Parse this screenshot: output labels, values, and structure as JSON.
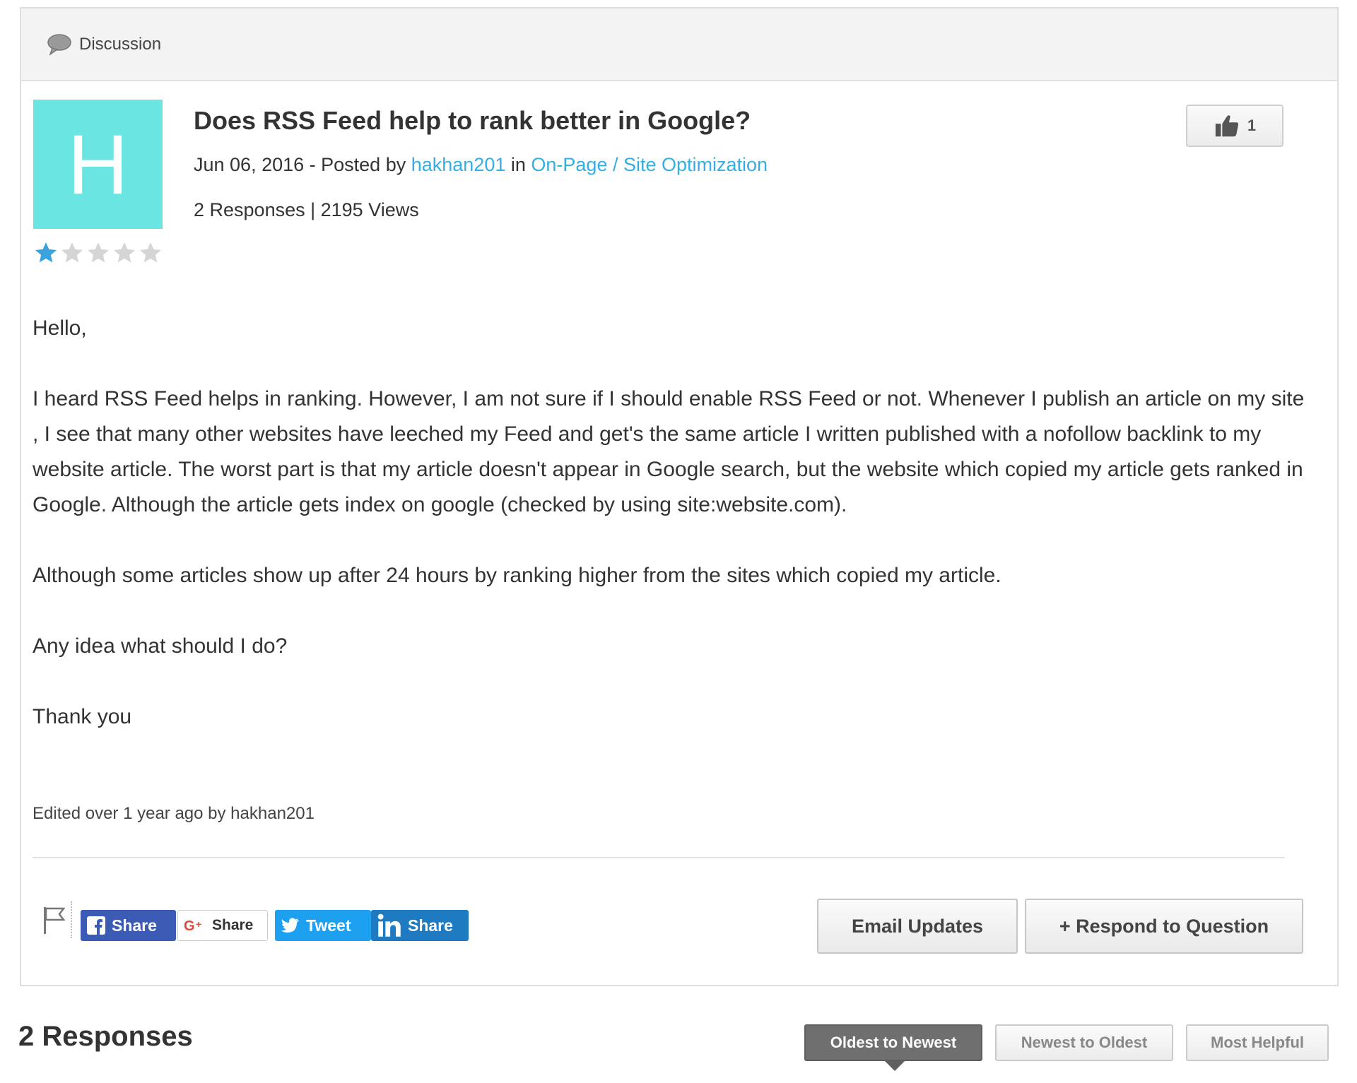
{
  "panel": {
    "header_label": "Discussion",
    "header_icon": "speech-bubble-icon"
  },
  "question": {
    "avatar_letter": "H",
    "avatar_color": "#6be5e2",
    "rating": 1,
    "rating_max": 5,
    "title": "Does RSS Feed help to rank better in Google?",
    "date_prefix": "Jun 06, 2016 - Posted by ",
    "author": "hakhan201",
    "in_word": " in ",
    "category": "On-Page / Site Optimization",
    "stats": "2 Responses | 2195 Views",
    "likes": "1",
    "body": [
      "Hello,",
      "I heard RSS Feed helps in ranking. However, I am not sure if I should enable RSS Feed or not. Whenever I publish an article on my site , I see that many other websites have leeched my Feed and get's the same article I written published with a nofollow backlink to my website article. The worst part is that my article doesn't appear in Google search, but the website which copied my article gets ranked in Google. Although the article gets index on google (checked by using site:website.com).",
      "Although some articles show up after 24 hours by ranking higher from the sites which copied my article.",
      "Any idea what should I do?",
      "Thank you"
    ],
    "edited": "Edited over 1 year ago by hakhan201"
  },
  "share": {
    "facebook": "Share",
    "google": "Share",
    "twitter": "Tweet",
    "linkedin": "Share"
  },
  "actions": {
    "email": "Email Updates",
    "respond": "+ Respond to Question"
  },
  "responses": {
    "title": "2 Responses",
    "sort_oldest": "Oldest to Newest",
    "sort_newest": "Newest to Oldest",
    "sort_helpful": "Most Helpful"
  },
  "colors": {
    "link": "#35aee4",
    "star_active": "#3aa3dc",
    "star_inactive": "#d5d5d5"
  }
}
